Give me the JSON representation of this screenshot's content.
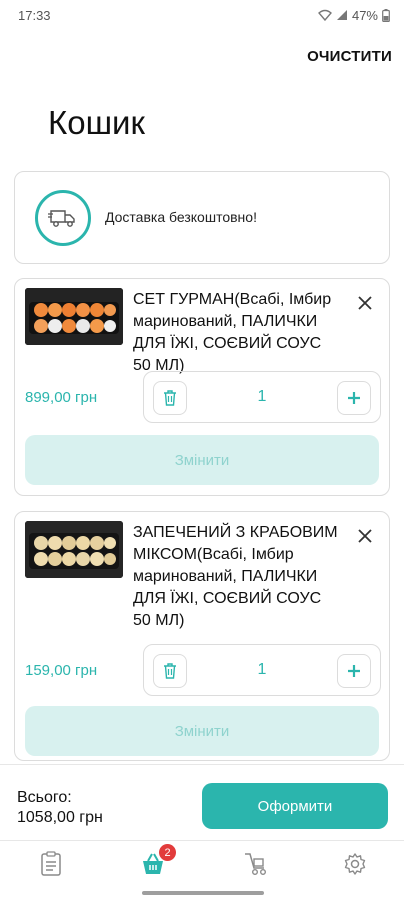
{
  "status_bar": {
    "time": "17:33",
    "battery": "47%"
  },
  "header": {
    "clear_label": "ОЧИСТИТИ",
    "title": "Кошик"
  },
  "delivery": {
    "text": "Доставка безкоштовно!",
    "icon": "delivery-truck-icon"
  },
  "cart_items": [
    {
      "name": "СЕТ ГУРМАН(Всабі, Імбир маринований, ПАЛИЧКИ ДЛЯ ЇЖІ, СОЄВИЙ СОУС 50 МЛ)",
      "price": "899,00 грн",
      "quantity": "1",
      "change_label": "Змінити"
    },
    {
      "name": "ЗАПЕЧЕНИЙ З КРАБОВИМ МІКСОМ(Всабі, Імбир маринований, ПАЛИЧКИ ДЛЯ ЇЖІ, СОЄВИЙ СОУС 50 МЛ)",
      "price": "159,00 грн",
      "quantity": "1",
      "change_label": "Змінити"
    }
  ],
  "checkout": {
    "total_label": "Всього:",
    "total_value": "1058,00 грн",
    "button_label": "Оформити"
  },
  "bottom_nav": {
    "items": [
      {
        "icon": "menu-list-icon"
      },
      {
        "icon": "cart-icon",
        "badge": "2",
        "active": true
      },
      {
        "icon": "delivery-courier-icon"
      },
      {
        "icon": "settings-gear-icon"
      }
    ]
  },
  "colors": {
    "accent": "#2bb5ad",
    "accent_light": "#d8f1ef",
    "badge": "#e23b3b",
    "border": "#dcdcdc"
  }
}
